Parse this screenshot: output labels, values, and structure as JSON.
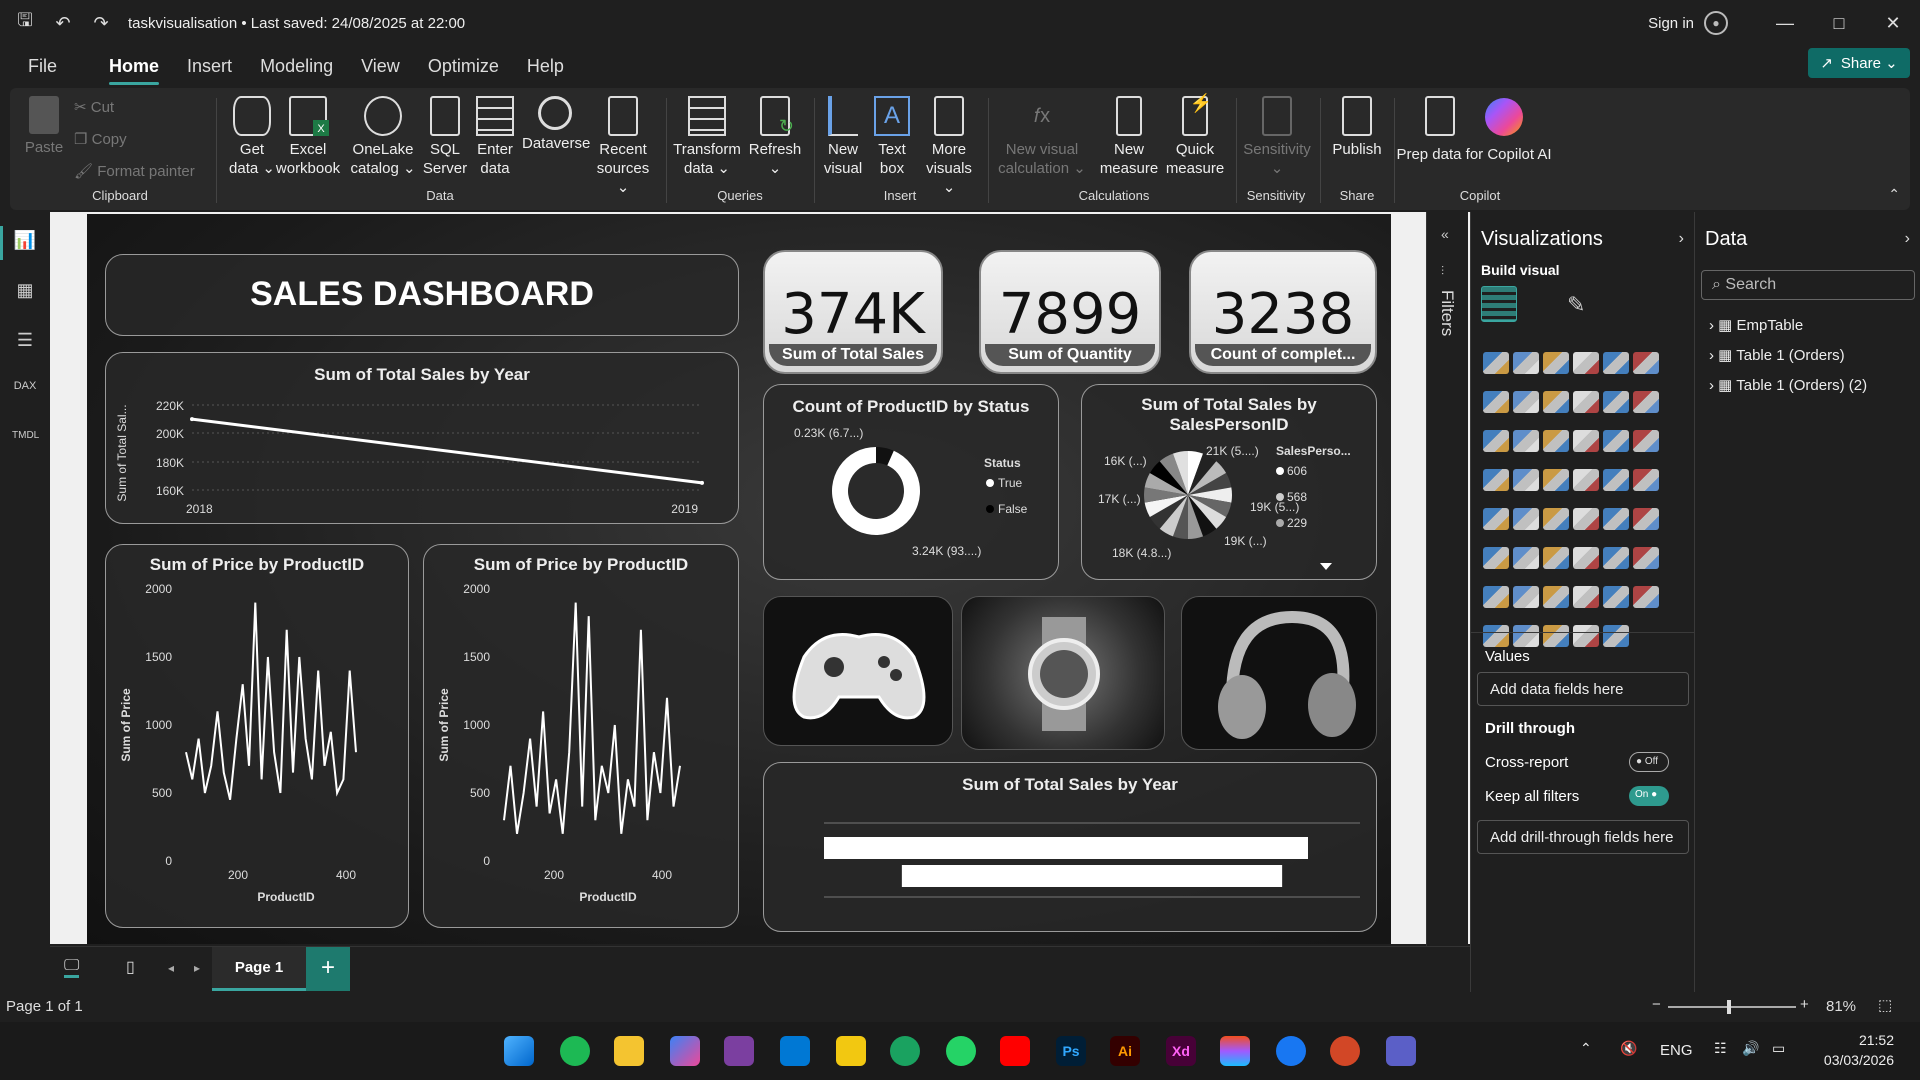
{
  "titlebar": {
    "title": "taskvisualisation • Last saved: 24/08/2025 at 22:00",
    "signin": "Sign in"
  },
  "menu": {
    "items": [
      "File",
      "Home",
      "Insert",
      "Modeling",
      "View",
      "Optimize",
      "Help"
    ],
    "active": "Home"
  },
  "share": {
    "label": "Share"
  },
  "ribbon": {
    "clipboard": {
      "paste": "Paste",
      "cut": "Cut",
      "copy": "Copy",
      "format_painter": "Format painter",
      "group": "Clipboard"
    },
    "data": {
      "get_data": "Get data",
      "excel": "Excel workbook",
      "onelake": "OneLake catalog",
      "sql": "SQL Server",
      "enter_data": "Enter data",
      "dataverse": "Dataverse",
      "recent": "Recent sources",
      "group": "Data"
    },
    "queries": {
      "transform": "Transform data",
      "refresh": "Refresh",
      "group": "Queries"
    },
    "insert": {
      "new_visual": "New visual",
      "text_box": "Text box",
      "more_visuals": "More visuals",
      "group": "Insert"
    },
    "calculations": {
      "new_visual_calc": "New visual calculation",
      "new_measure": "New measure",
      "quick_measure": "Quick measure",
      "group": "Calculations"
    },
    "sensitivity": {
      "label": "Sensitivity",
      "group": "Sensitivity"
    },
    "share": {
      "publish": "Publish",
      "group": "Share"
    },
    "copilot": {
      "prep": "Prep data for Copilot AI",
      "group": "Copilot"
    }
  },
  "dashboard": {
    "title": "SALES DASHBOARD",
    "kpis": [
      {
        "value": "374K",
        "label": "Sum of Total Sales"
      },
      {
        "value": "7899",
        "label": "Sum of Quantity"
      },
      {
        "value": "3238",
        "label": "Count of complet..."
      }
    ]
  },
  "chart_data": [
    {
      "type": "line",
      "title": "Sum of Total Sales by Year",
      "ylabel": "Sum of Total Sal...",
      "x": [
        "2018",
        "2019"
      ],
      "y": [
        210000,
        165000
      ],
      "yticks": [
        "220K",
        "200K",
        "180K",
        "160K"
      ],
      "ylim": [
        160000,
        220000
      ]
    },
    {
      "type": "line",
      "title": "Sum of Price by ProductID",
      "xlabel": "ProductID",
      "ylabel": "Sum of Price",
      "xticks": [
        "200",
        "400"
      ],
      "yticks": [
        "2000",
        "1500",
        "1000",
        "500",
        "0"
      ],
      "ylim": [
        0,
        2000
      ],
      "y": [
        800,
        600,
        900,
        500,
        700,
        1100,
        650,
        450,
        900,
        1300,
        700,
        1900,
        600,
        1500,
        800,
        500,
        1700,
        650,
        1500,
        900,
        600,
        1400,
        700,
        950,
        500,
        600,
        1400,
        800
      ]
    },
    {
      "type": "line",
      "title": "Sum of Price by ProductID",
      "xlabel": "ProductID",
      "ylabel": "Sum of Price",
      "xticks": [
        "200",
        "400"
      ],
      "yticks": [
        "2000",
        "1500",
        "1000",
        "500",
        "0"
      ],
      "ylim": [
        0,
        2000
      ],
      "y": [
        300,
        700,
        200,
        500,
        900,
        400,
        1100,
        350,
        600,
        200,
        800,
        1900,
        400,
        1800,
        300,
        700,
        500,
        1000,
        200,
        600,
        400,
        1700,
        300,
        800,
        500,
        1200,
        400,
        700
      ]
    },
    {
      "type": "pie",
      "title": "Count of ProductID by Status",
      "legend_title": "Status",
      "categories": [
        "True",
        "False"
      ],
      "values": [
        230,
        3240
      ],
      "labels": [
        "0.23K (6.7...)",
        "3.24K (93....)"
      ]
    },
    {
      "type": "pie",
      "title": "Sum of Total Sales by SalesPersonID",
      "legend_title": "SalesPerso...",
      "legend": [
        "606",
        "568",
        "229"
      ],
      "labels": [
        "16K (...)",
        "21K (5....)",
        "17K (...)",
        "19K (5...)",
        "19K (...)",
        "18K (4.8...)"
      ]
    },
    {
      "type": "bar",
      "title": "Sum of Total Sales by Year",
      "values": [
        210000,
        165000
      ]
    }
  ],
  "visualizations": {
    "title": "Visualizations",
    "build": "Build visual",
    "values": "Values",
    "add_fields": "Add data fields here",
    "drill": "Drill through",
    "cross": "Cross-report",
    "cross_state": "Off",
    "keep": "Keep all filters",
    "keep_state": "On",
    "add_drill": "Add drill-through fields here"
  },
  "filters": {
    "label": "Filters"
  },
  "datapane": {
    "title": "Data",
    "search": "Search",
    "tables": [
      "EmpTable",
      "Table 1 (Orders)",
      "Table 1 (Orders) (2)"
    ]
  },
  "pages": {
    "current": "Page 1"
  },
  "status": {
    "page": "Page 1 of 1",
    "zoom": "81%"
  },
  "taskbar": {
    "lang": "ENG",
    "time": "21:52",
    "date": "03/03/2026"
  }
}
